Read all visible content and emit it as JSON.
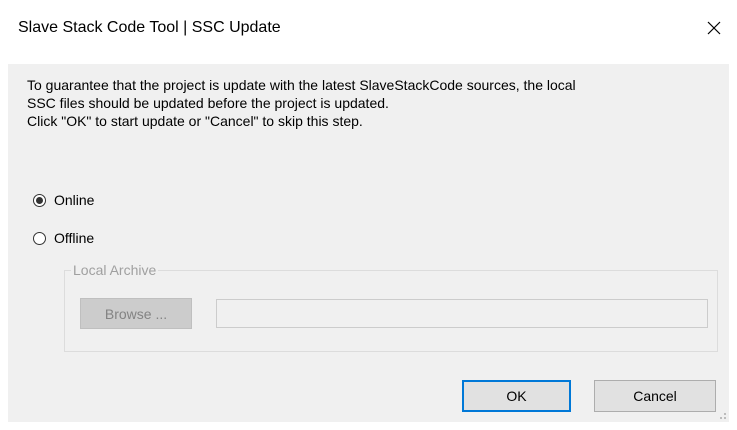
{
  "window": {
    "title": "Slave Stack Code Tool | SSC Update"
  },
  "message": {
    "line1": "To guarantee that the project is update with the latest SlaveStackCode sources, the local",
    "line2": "SSC files should be updated before the project is updated.",
    "line3": "Click \"OK\" to start update or \"Cancel\" to skip this step."
  },
  "options": {
    "online_label": "Online",
    "offline_label": "Offline",
    "selected": "Online"
  },
  "local_archive": {
    "legend": "Local Archive",
    "browse_label": "Browse ...",
    "path_value": ""
  },
  "buttons": {
    "ok_label": "OK",
    "cancel_label": "Cancel"
  },
  "colors": {
    "default_button_border": "#0078d7",
    "client_background": "#f0f0f0",
    "disabled_text": "#838383"
  },
  "icons": {
    "close": "close-icon",
    "resize": "resize-grip-icon"
  }
}
